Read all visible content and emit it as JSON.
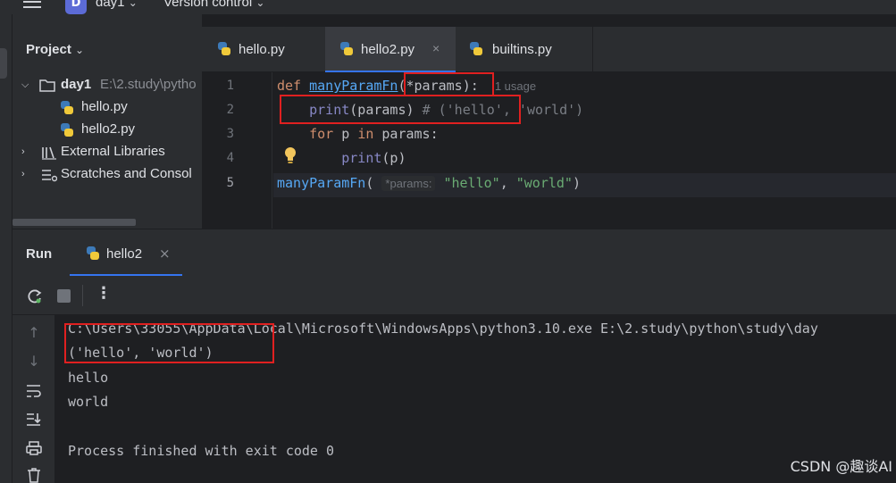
{
  "titlebar": {
    "project_badge": "D",
    "project_name": "day1",
    "vcs_label": "Version control"
  },
  "project_panel": {
    "title": "Project",
    "tree": [
      {
        "label": "day1",
        "suffix": "E:\\2.study\\pytho"
      },
      {
        "label": "hello.py"
      },
      {
        "label": "hello2.py"
      },
      {
        "label": "External Libraries"
      },
      {
        "label": "Scratches and Consol"
      }
    ]
  },
  "editor": {
    "tabs": [
      {
        "label": "hello.py"
      },
      {
        "label": "hello2.py",
        "active": true,
        "close": "×"
      },
      {
        "label": "builtins.py"
      }
    ],
    "line_numbers": [
      "1",
      "2",
      "3",
      "4",
      "5"
    ],
    "lines": {
      "l1": {
        "kw": "def",
        "fn": "manyParamFn",
        "params": "(*params):",
        "hint": "1 usage"
      },
      "l2": {
        "bi": "print",
        "rest": "(params)",
        "comment": "# ('hello', 'world')"
      },
      "l3": {
        "kw1": "for",
        "mid": " p ",
        "kw2": "in",
        "rest": " params:"
      },
      "l4": {
        "bi": "print",
        "rest": "(p)"
      },
      "l5": {
        "fn": "manyParamFn",
        "open": "(",
        "inlay": "*params:",
        "s1": "\"hello\"",
        "comma": ", ",
        "s2": "\"world\"",
        "close": ")"
      }
    }
  },
  "run": {
    "title": "Run",
    "tab_label": "hello2",
    "tab_close": "×",
    "console": [
      "C:\\Users\\33055\\AppData\\Local\\Microsoft\\WindowsApps\\python3.10.exe E:\\2.study\\python\\study\\day",
      "('hello', 'world')",
      "hello",
      "world",
      "",
      "Process finished with exit code 0"
    ]
  },
  "watermark": "CSDN @趣谈AI",
  "colors": {
    "accent": "#3574f0",
    "annotation": "#e02020",
    "keyword": "#cf8e6d",
    "function": "#56a8f5",
    "string": "#6aab73"
  }
}
